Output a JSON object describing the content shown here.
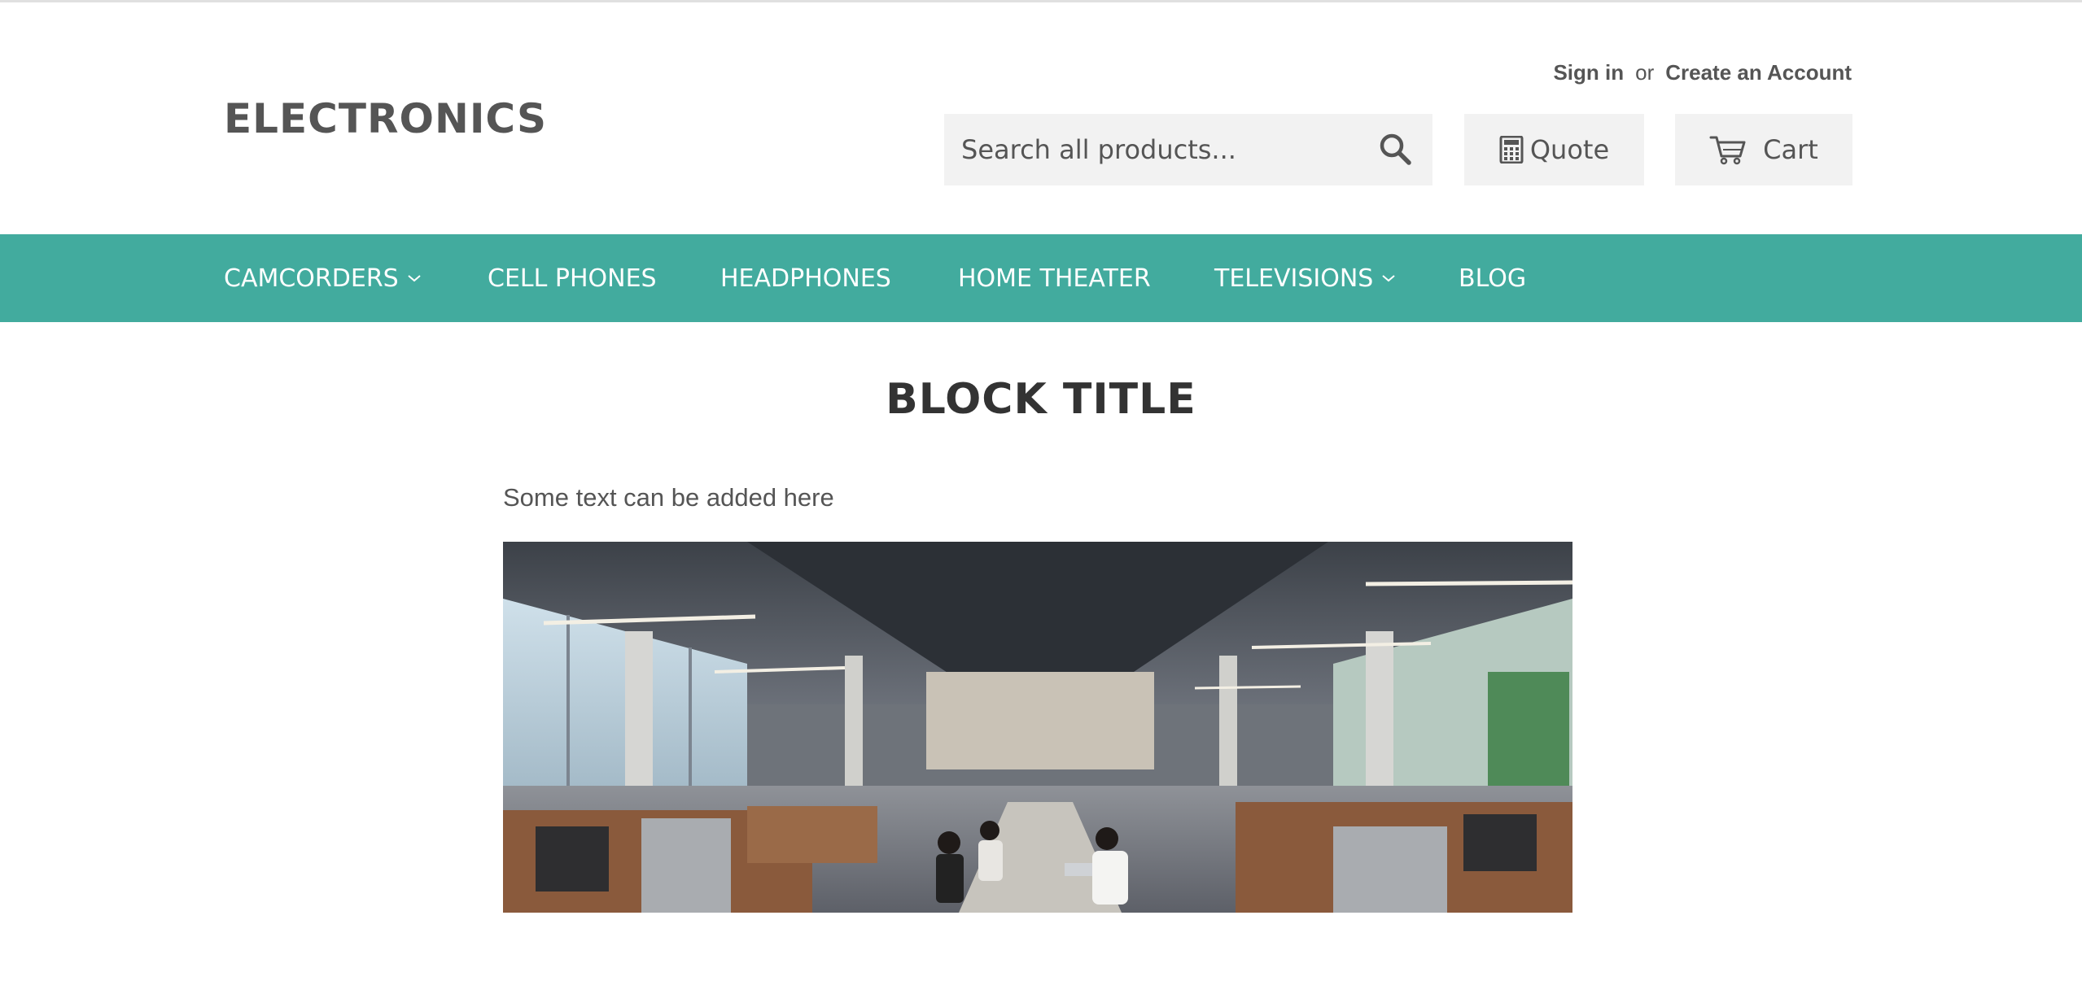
{
  "header": {
    "logo": "ELECTRONICS",
    "sign_in": "Sign in",
    "or": "or",
    "create_account": "Create an Account",
    "search_placeholder": "Search all products...",
    "quote_label": "Quote",
    "cart_label": "Cart",
    "search_icon": "search-icon",
    "quote_icon": "calculator-icon",
    "cart_icon": "cart-icon"
  },
  "nav": {
    "items": [
      {
        "label": "CAMCORDERS",
        "has_dropdown": true
      },
      {
        "label": "CELL PHONES",
        "has_dropdown": false
      },
      {
        "label": "HEADPHONES",
        "has_dropdown": false
      },
      {
        "label": "HOME THEATER",
        "has_dropdown": false
      },
      {
        "label": "TELEVISIONS",
        "has_dropdown": true
      },
      {
        "label": "BLOG",
        "has_dropdown": false
      }
    ]
  },
  "content": {
    "title": "BLOCK TITLE",
    "text": "Some text can be added here"
  },
  "colors": {
    "nav_bg": "#42ab9e",
    "button_bg": "#f2f2f2",
    "text_dark": "#333333",
    "text_muted": "#555555"
  }
}
